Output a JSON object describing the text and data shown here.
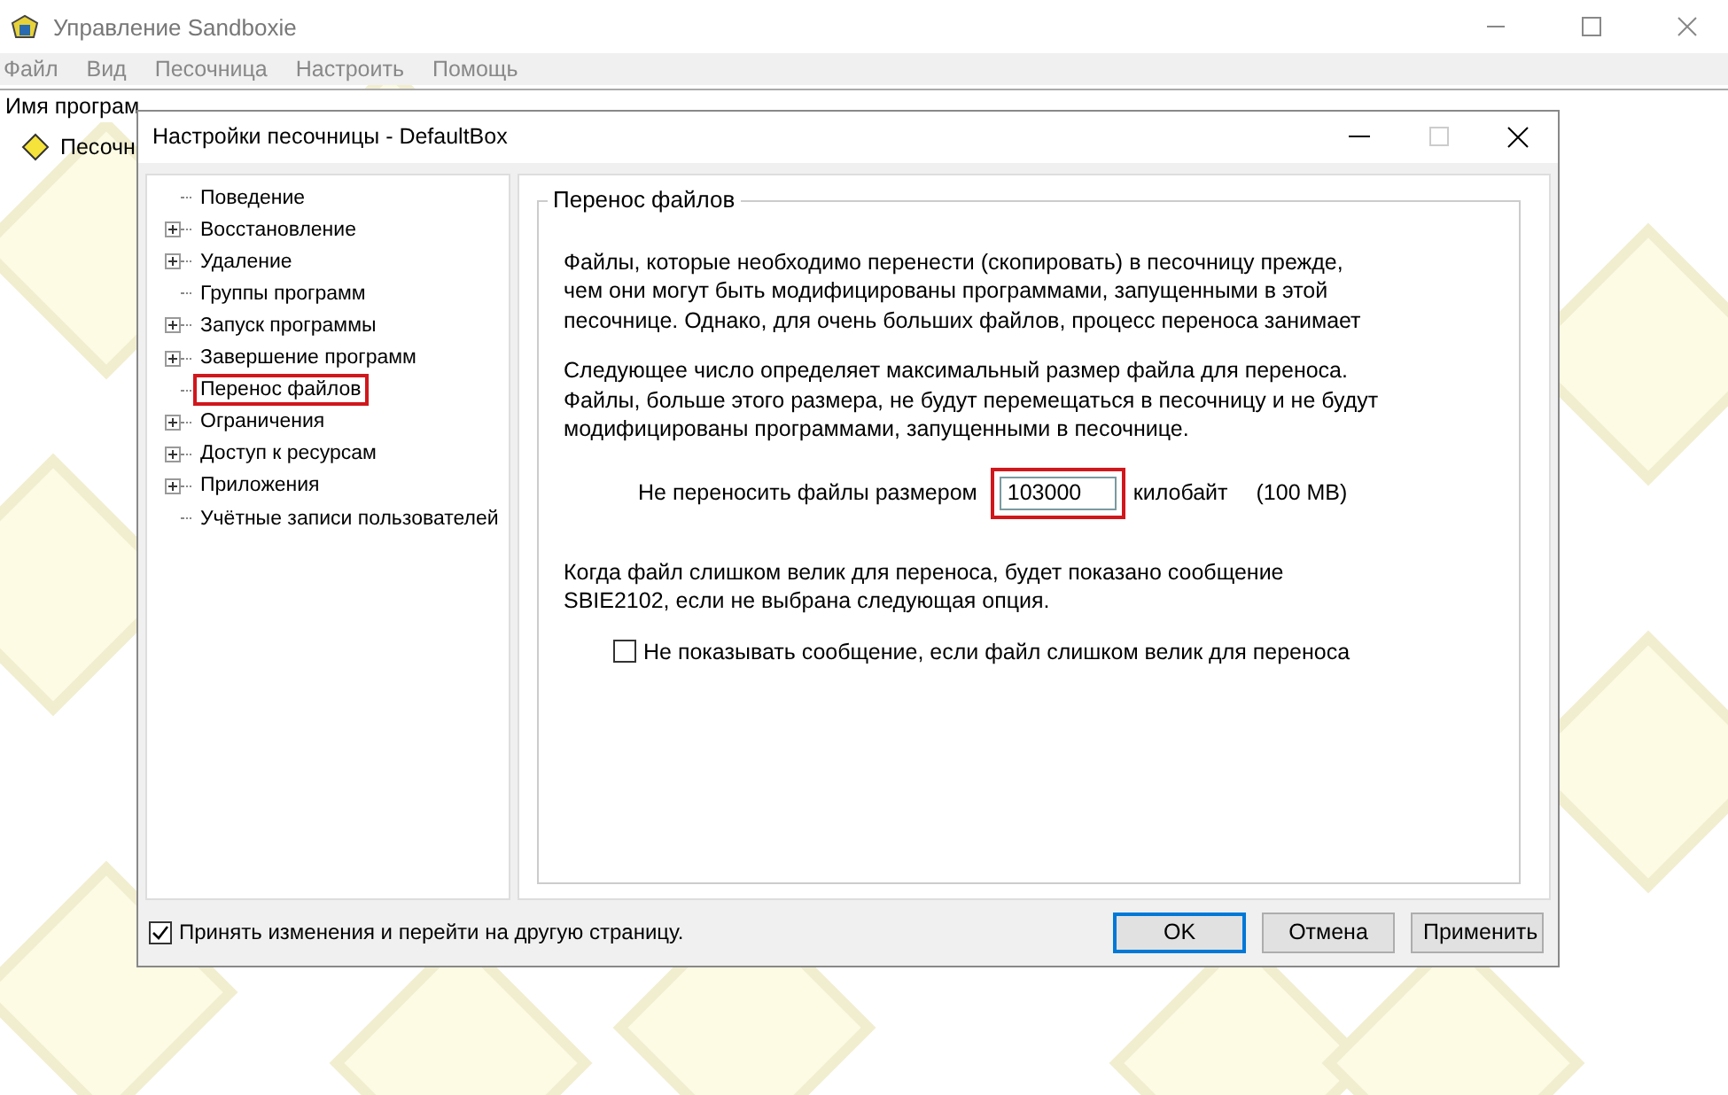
{
  "window": {
    "title": "Управление Sandboxie"
  },
  "menu": [
    "Файл",
    "Вид",
    "Песочница",
    "Настроить",
    "Помощь"
  ],
  "list": {
    "column_1": "Имя програм",
    "tree_item": "Песочн"
  },
  "dialog": {
    "title": "Настройки песочницы - DefaultBox",
    "tree": [
      {
        "label": "Поведение",
        "expandable": false,
        "highlighted": false
      },
      {
        "label": "Восстановление",
        "expandable": true,
        "highlighted": false
      },
      {
        "label": "Удаление",
        "expandable": true,
        "highlighted": false
      },
      {
        "label": "Группы программ",
        "expandable": false,
        "highlighted": false
      },
      {
        "label": "Запуск программы",
        "expandable": true,
        "highlighted": false
      },
      {
        "label": "Завершение программ",
        "expandable": true,
        "highlighted": false
      },
      {
        "label": "Перенос файлов",
        "expandable": false,
        "highlighted": true
      },
      {
        "label": "Ограничения",
        "expandable": true,
        "highlighted": false
      },
      {
        "label": "Доступ к ресурсам",
        "expandable": true,
        "highlighted": false
      },
      {
        "label": "Приложения",
        "expandable": true,
        "highlighted": false
      },
      {
        "label": "Учётные записи пользователей",
        "expandable": false,
        "highlighted": false
      }
    ],
    "group_title": "Перенос файлов",
    "paragraph_1": [
      "Файлы, которые необходимо перенести (скопировать) в песочницу прежде,",
      "чем они могут быть модифицированы программами, запущенными в этой",
      "песочнице.  Однако, для очень больших файлов, процесс переноса занимает"
    ],
    "paragraph_2": [
      "Следующее число определяет максимальный размер файла для переноса.",
      "Файлы, больше этого размера, не будут перемещаться в песочницу и не будут",
      "модифицированы программами, запущенными в песочнице."
    ],
    "size_label": "Не переносить файлы размером",
    "size_value": "103000",
    "size_highlighted": true,
    "size_unit": "килобайт",
    "size_mb": "(100 MB)",
    "paragraph_3": [
      "Когда файл слишком велик для переноса, будет показано сообщение",
      "SBIE2102, если не выбрана следующая опция."
    ],
    "suppress_option": {
      "label": "Не показывать сообщение, если файл слишком велик для переноса",
      "checked": false
    },
    "apply_option": {
      "label": "Принять изменения и перейти на другую страницу.",
      "checked": true
    },
    "buttons": [
      {
        "label": "OK",
        "default": true
      },
      {
        "label": "Отмена",
        "default": false
      },
      {
        "label": "Применить",
        "default": false
      }
    ]
  }
}
